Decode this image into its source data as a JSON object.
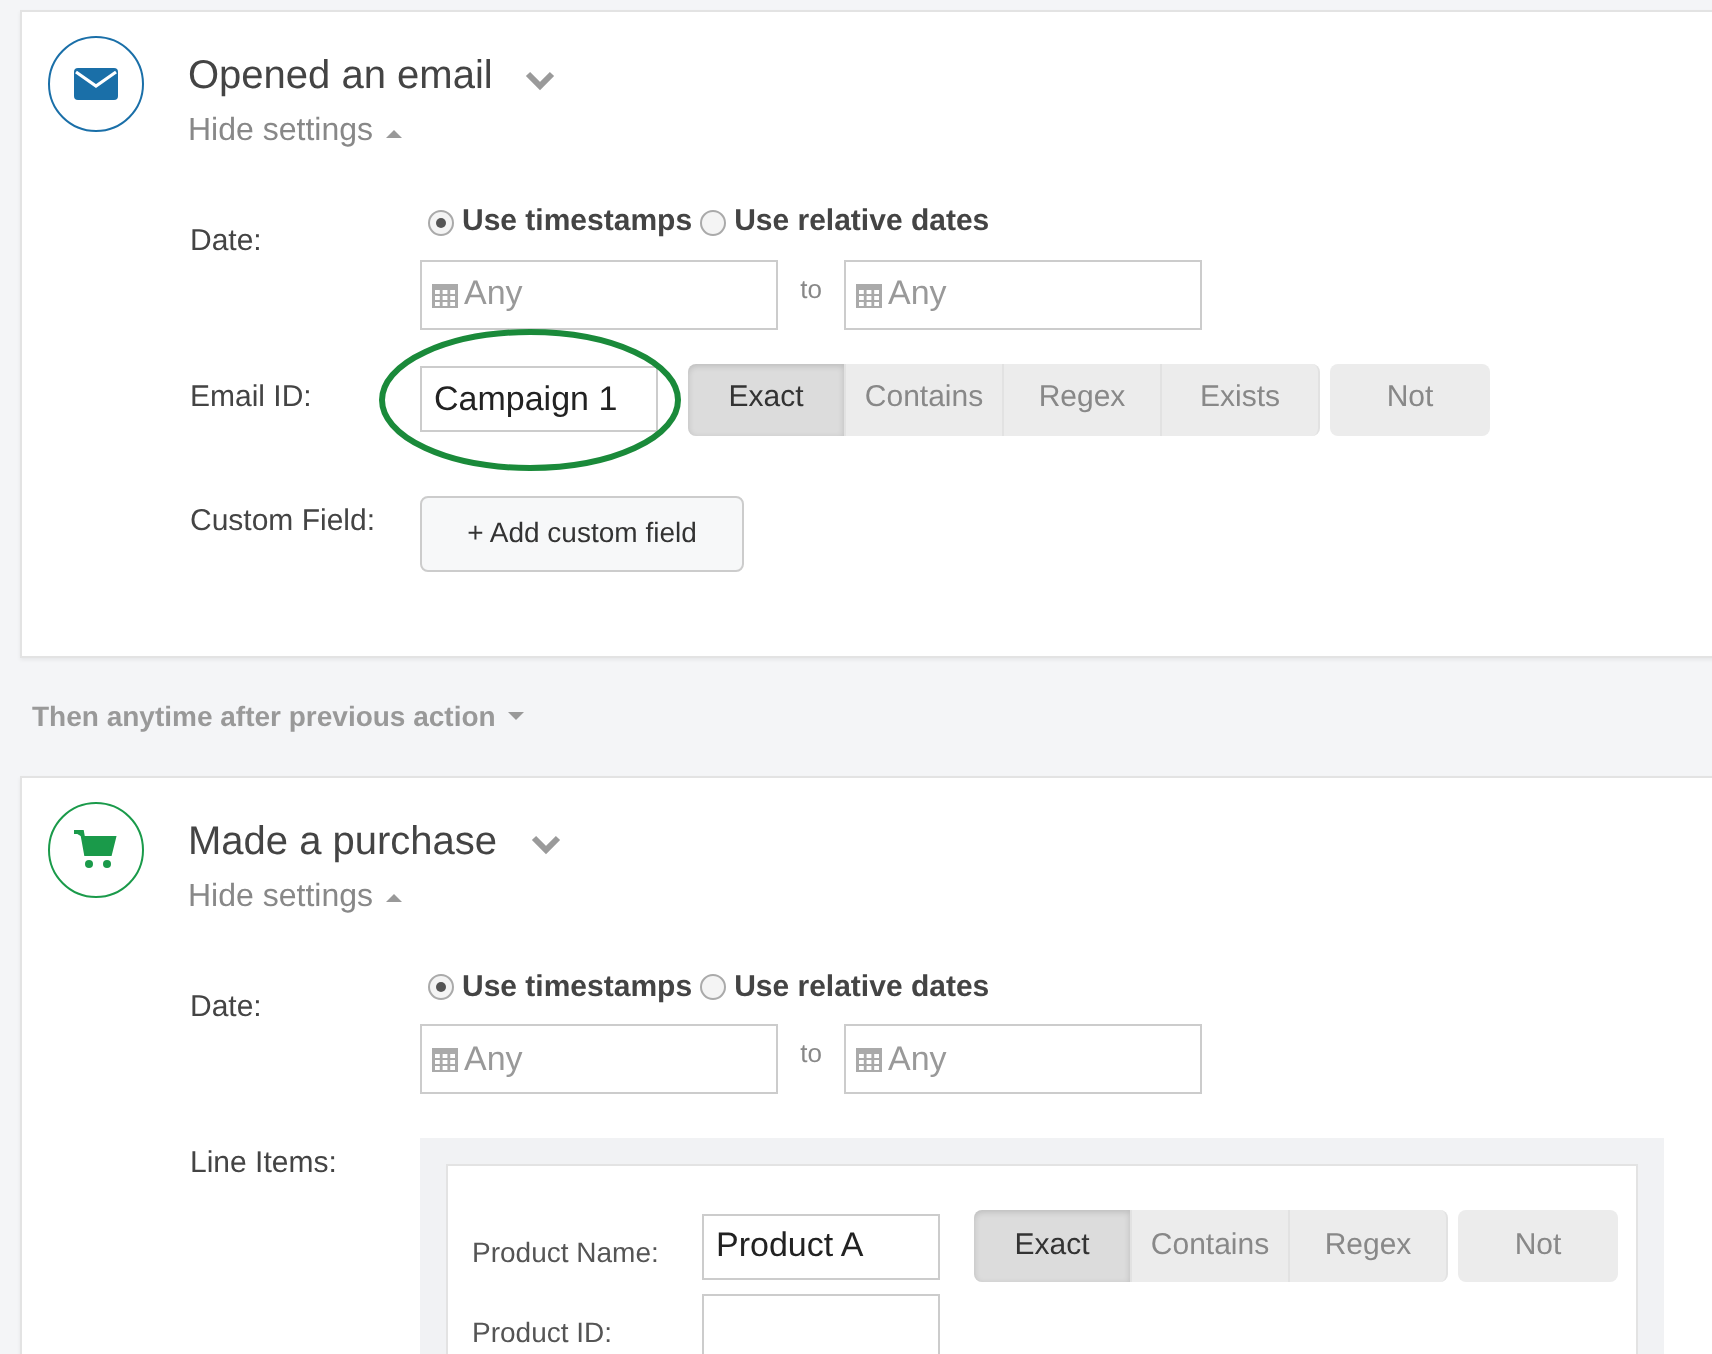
{
  "steps": [
    {
      "kind": "email",
      "color": "#1a6fa8",
      "title": "Opened an email",
      "settings_toggle": "Hide settings",
      "expanded": true,
      "date": {
        "label": "Date:",
        "modes": [
          {
            "label": "Use timestamps",
            "selected": true
          },
          {
            "label": "Use relative dates",
            "selected": false
          }
        ],
        "from": {
          "placeholder": "Any"
        },
        "separator": "to",
        "to": {
          "placeholder": "Any"
        }
      },
      "fields": [
        {
          "kind": "match",
          "label": "Email ID:",
          "value": "Campaign 1",
          "circled": true,
          "options": [
            {
              "label": "Exact",
              "selected": true
            },
            {
              "label": "Contains",
              "selected": false
            },
            {
              "label": "Regex",
              "selected": false
            },
            {
              "label": "Exists",
              "selected": false
            }
          ],
          "negate": {
            "label": "Not",
            "selected": false
          }
        },
        {
          "kind": "button",
          "label": "Custom Field:",
          "button": "+ Add custom field"
        }
      ]
    },
    {
      "connector": "Then anytime after previous action"
    },
    {
      "kind": "cart",
      "color": "#1a9a4a",
      "title": "Made a purchase",
      "settings_toggle": "Hide settings",
      "expanded": true,
      "date": {
        "label": "Date:",
        "modes": [
          {
            "label": "Use timestamps",
            "selected": true
          },
          {
            "label": "Use relative dates",
            "selected": false
          }
        ],
        "from": {
          "placeholder": "Any"
        },
        "separator": "to",
        "to": {
          "placeholder": "Any"
        }
      },
      "fields": [
        {
          "kind": "group",
          "label": "Line Items:",
          "items": [
            {
              "kind": "match",
              "label": "Product Name:",
              "value": "Product A",
              "circled": false,
              "options": [
                {
                  "label": "Exact",
                  "selected": true
                },
                {
                  "label": "Contains",
                  "selected": false
                },
                {
                  "label": "Regex",
                  "selected": false
                }
              ],
              "negate": {
                "label": "Not",
                "selected": false
              }
            },
            {
              "kind": "match",
              "label": "Product ID:",
              "value": ""
            }
          ]
        }
      ]
    }
  ]
}
